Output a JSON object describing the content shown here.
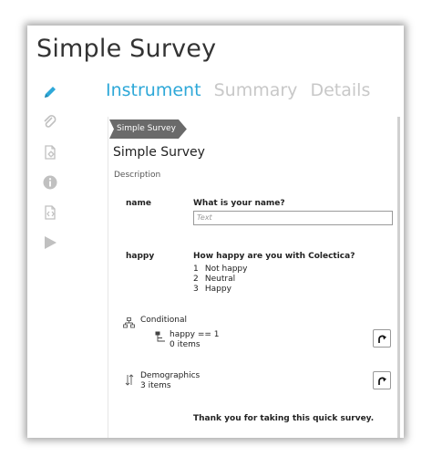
{
  "app": {
    "title": "Simple Survey"
  },
  "rail": {
    "icons": [
      "pencil-icon",
      "paperclip-icon",
      "document-gear-icon",
      "info-icon",
      "document-code-icon",
      "play-icon"
    ],
    "accent": "#2ea8d8",
    "inactive": "#c8c8c8"
  },
  "tabs": [
    {
      "label": "Instrument",
      "active": true
    },
    {
      "label": "Summary",
      "active": false
    },
    {
      "label": "Details",
      "active": false
    }
  ],
  "breadcrumb": {
    "label": "Simple Survey"
  },
  "survey": {
    "title": "Simple Survey",
    "description_label": "Description",
    "questions": [
      {
        "name": "name",
        "text": "What is your name?",
        "input_placeholder": "Text"
      },
      {
        "name": "happy",
        "text": "How happy are you with Colectica?",
        "options": [
          {
            "num": "1",
            "label": "Not happy"
          },
          {
            "num": "2",
            "label": "Neutral"
          },
          {
            "num": "3",
            "label": "Happy"
          }
        ]
      }
    ],
    "conditional": {
      "label": "Conditional",
      "branch_condition": "happy == 1",
      "branch_items": "0 items"
    },
    "demographics": {
      "label": "Demographics",
      "items": "3 items"
    },
    "closing": "Thank you for taking this quick survey."
  }
}
